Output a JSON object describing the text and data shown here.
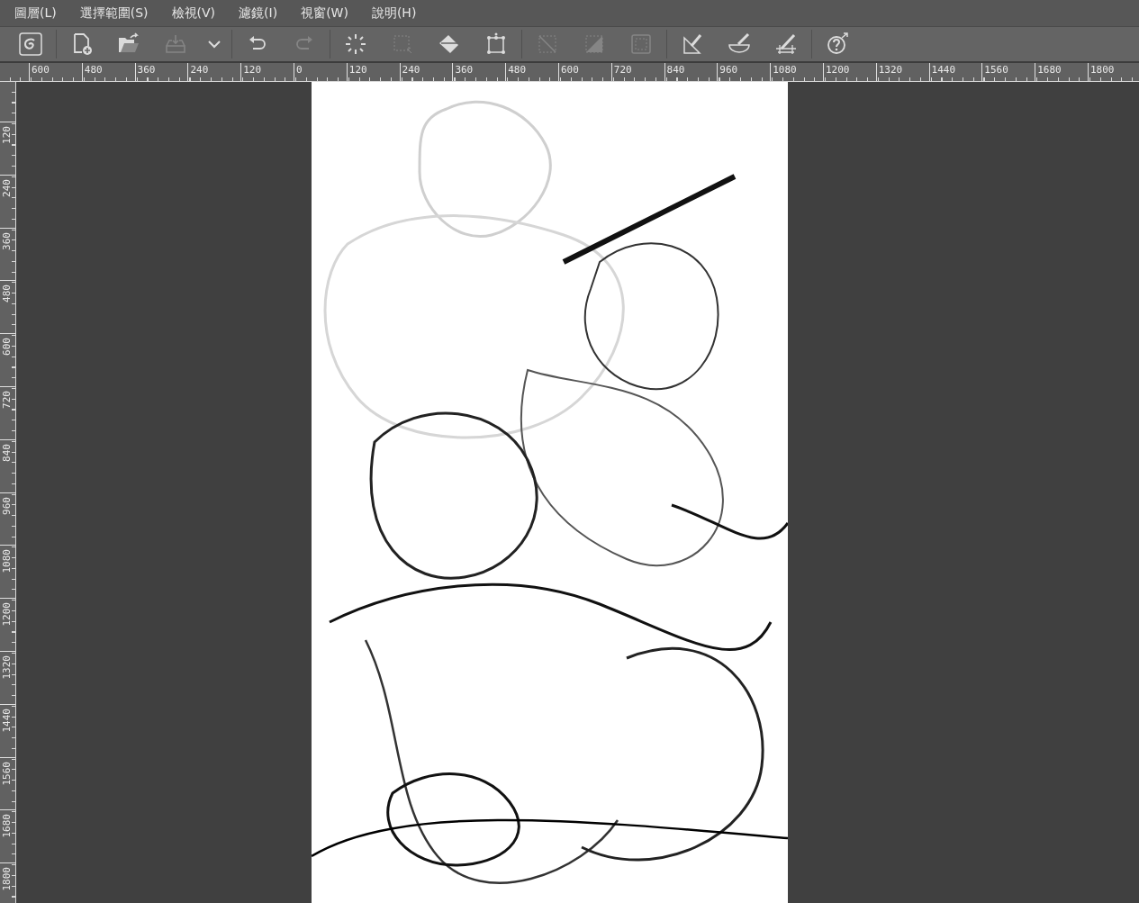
{
  "menu": [
    "圖層(L)",
    "選擇範圍(S)",
    "檢視(V)",
    "濾鏡(I)",
    "視窗(W)",
    "說明(H)"
  ],
  "toolbar": [
    [
      {
        "kind": "logo",
        "disabled": false
      }
    ],
    [
      {
        "kind": "new",
        "disabled": false
      },
      {
        "kind": "open",
        "disabled": false
      },
      {
        "kind": "export",
        "disabled": true
      },
      {
        "kind": "more",
        "disabled": false
      }
    ],
    [
      {
        "kind": "undo",
        "disabled": false
      },
      {
        "kind": "redo",
        "disabled": true
      }
    ],
    [
      {
        "kind": "select",
        "disabled": false
      },
      {
        "kind": "deselect",
        "disabled": true
      },
      {
        "kind": "fill",
        "disabled": false
      },
      {
        "kind": "transform",
        "disabled": false
      }
    ],
    [
      {
        "kind": "clear",
        "disabled": true
      },
      {
        "kind": "trim",
        "disabled": true
      },
      {
        "kind": "invert",
        "disabled": true
      }
    ],
    [
      {
        "kind": "straight",
        "disabled": false
      },
      {
        "kind": "curve",
        "disabled": false
      },
      {
        "kind": "perspective",
        "disabled": false
      }
    ],
    [
      {
        "kind": "help",
        "disabled": false
      }
    ]
  ],
  "ruler_horizontal": [
    "600",
    "480",
    "360",
    "240",
    "120",
    "0",
    "120",
    "240",
    "360",
    "480",
    "600",
    "720",
    "840",
    "960",
    "1080",
    "1200",
    "1320",
    "1440",
    "1560",
    "1680",
    "1800"
  ],
  "ruler_vertical": [
    "120",
    "240",
    "360",
    "480",
    "600",
    "720",
    "840",
    "960",
    "1080",
    "1200",
    "1320",
    "1440",
    "1560",
    "1680",
    "1800"
  ],
  "canvas": {
    "kind": "picture"
  }
}
